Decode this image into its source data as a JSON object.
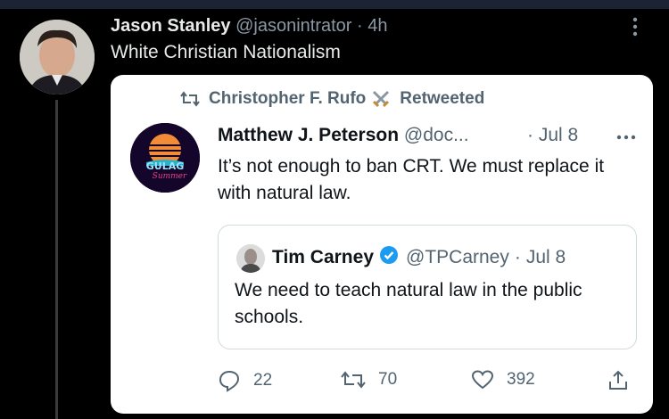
{
  "tweet": {
    "author_name": "Jason Stanley",
    "author_handle": "@jasonintrator",
    "separator": "·",
    "time": "4h",
    "text": "White Christian Nationalism"
  },
  "embedded": {
    "retweeted_by": "Christopher F. Rufo",
    "retweeted_label": "Retweeted",
    "author_name": "Matthew J. Peterson",
    "author_handle": "@doc...",
    "time": "· Jul 8",
    "text": "It’s not enough to ban CRT. We must replace it with natural law.",
    "avatar_text": "GULAG",
    "avatar_subtext": "Summer",
    "quoted": {
      "author_name": "Tim Carney",
      "author_handle": "@TPCarney",
      "separator": "·",
      "time": "Jul 8",
      "text": "We need to teach natural law in the public schools."
    },
    "actions": {
      "reply_count": "22",
      "retweet_count": "70",
      "like_count": "392"
    }
  },
  "colors": {
    "background": "#000000",
    "card": "#ffffff",
    "muted_dark": "#8b98a5",
    "muted_light": "#536471",
    "verified": "#1d9bf0"
  }
}
